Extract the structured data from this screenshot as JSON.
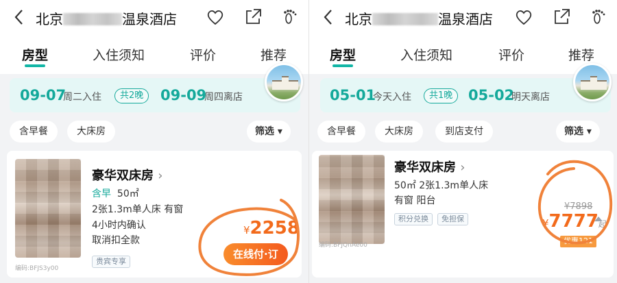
{
  "left": {
    "header": {
      "title_prefix": "北京",
      "title_suffix": "温泉酒店"
    },
    "tabs": [
      "房型",
      "入住须知",
      "评价",
      "推荐"
    ],
    "dates": {
      "checkin_date": "09-07",
      "checkin_label": "周二入住",
      "nights": "共2晚",
      "checkout_date": "09-09",
      "checkout_label": "周四离店"
    },
    "filters": [
      "含早餐",
      "大床房"
    ],
    "sort_label": "筛选",
    "room": {
      "name": "豪华双床房",
      "chevron": "›",
      "breakfast": "含早",
      "area": "50㎡",
      "beds": "2张1.3m单人床  有窗",
      "confirm": "4小时内确认",
      "cancel": "取消扣全款",
      "code": "编码:BFJS3y00",
      "tag": "贵宾专享",
      "currency": "¥",
      "price": "2258",
      "button": "在线付·订"
    }
  },
  "right": {
    "header": {
      "title_prefix": "北京",
      "title_suffix": "温泉酒店"
    },
    "tabs": [
      "房型",
      "入住须知",
      "评价",
      "推荐"
    ],
    "dates": {
      "checkin_date": "05-01",
      "checkin_label": "今天入住",
      "nights": "共1晚",
      "checkout_date": "05-02",
      "checkout_label": "明天离店"
    },
    "filters": [
      "含早餐",
      "大床房",
      "到店支付"
    ],
    "sort_label": "筛选",
    "room": {
      "name": "豪华双床房",
      "chevron": "›",
      "line1": "50㎡  2张1.3m单人床",
      "line2": "有窗  阳台",
      "tags": [
        "积分兑换",
        "免担保"
      ],
      "code": "编码:BFJQnAe00",
      "original_price": "¥7898",
      "currency": "¥",
      "price": "7777",
      "price_suffix": "起",
      "discount": "优惠121"
    }
  },
  "colors": {
    "accent": "#14a99b",
    "price": "#f26a1b",
    "highlight": "#f0823a"
  }
}
